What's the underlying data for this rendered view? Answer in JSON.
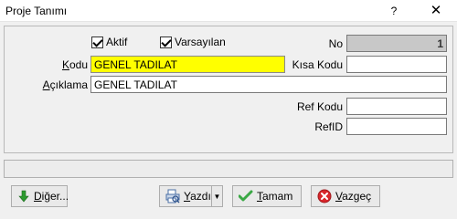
{
  "window": {
    "title": "Proje Tanımı",
    "help_label": "?",
    "close_label": "✕"
  },
  "form": {
    "aktif": {
      "label": "Aktif",
      "checked": true
    },
    "varsayilan": {
      "label": "Varsayılan",
      "checked": true
    },
    "no": {
      "label": "No",
      "value": "1"
    },
    "kodu": {
      "label_first": "K",
      "label_rest": "odu",
      "value": "GENEL TADILAT"
    },
    "kisa_kodu": {
      "label": "Kısa Kodu",
      "value": ""
    },
    "aciklama": {
      "label_first": "A",
      "label_rest": "çıklama",
      "value": "GENEL TADILAT"
    },
    "ref_kodu": {
      "label": "Ref Kodu",
      "value": ""
    },
    "ref_id": {
      "label": "RefID",
      "value": ""
    }
  },
  "buttons": {
    "diger": {
      "label_first": "D",
      "label_rest": "iğer..."
    },
    "yazdir": {
      "label_first": "Y",
      "label_rest": "azdır"
    },
    "tamam": {
      "label_first": "T",
      "label_rest": "amam"
    },
    "vazgec": {
      "label_first": "V",
      "label_rest": "azgeç"
    }
  },
  "colors": {
    "kodu_highlight": "#ffff00",
    "tamam_check": "#3aa845",
    "vazgec_icon": "#d9262b",
    "diger_arrow": "#2c9a2f"
  },
  "icons": {
    "diger": "down-arrow-icon",
    "yazdir": "printer-icon",
    "tamam": "checkmark-icon",
    "vazgec": "cancel-icon"
  }
}
